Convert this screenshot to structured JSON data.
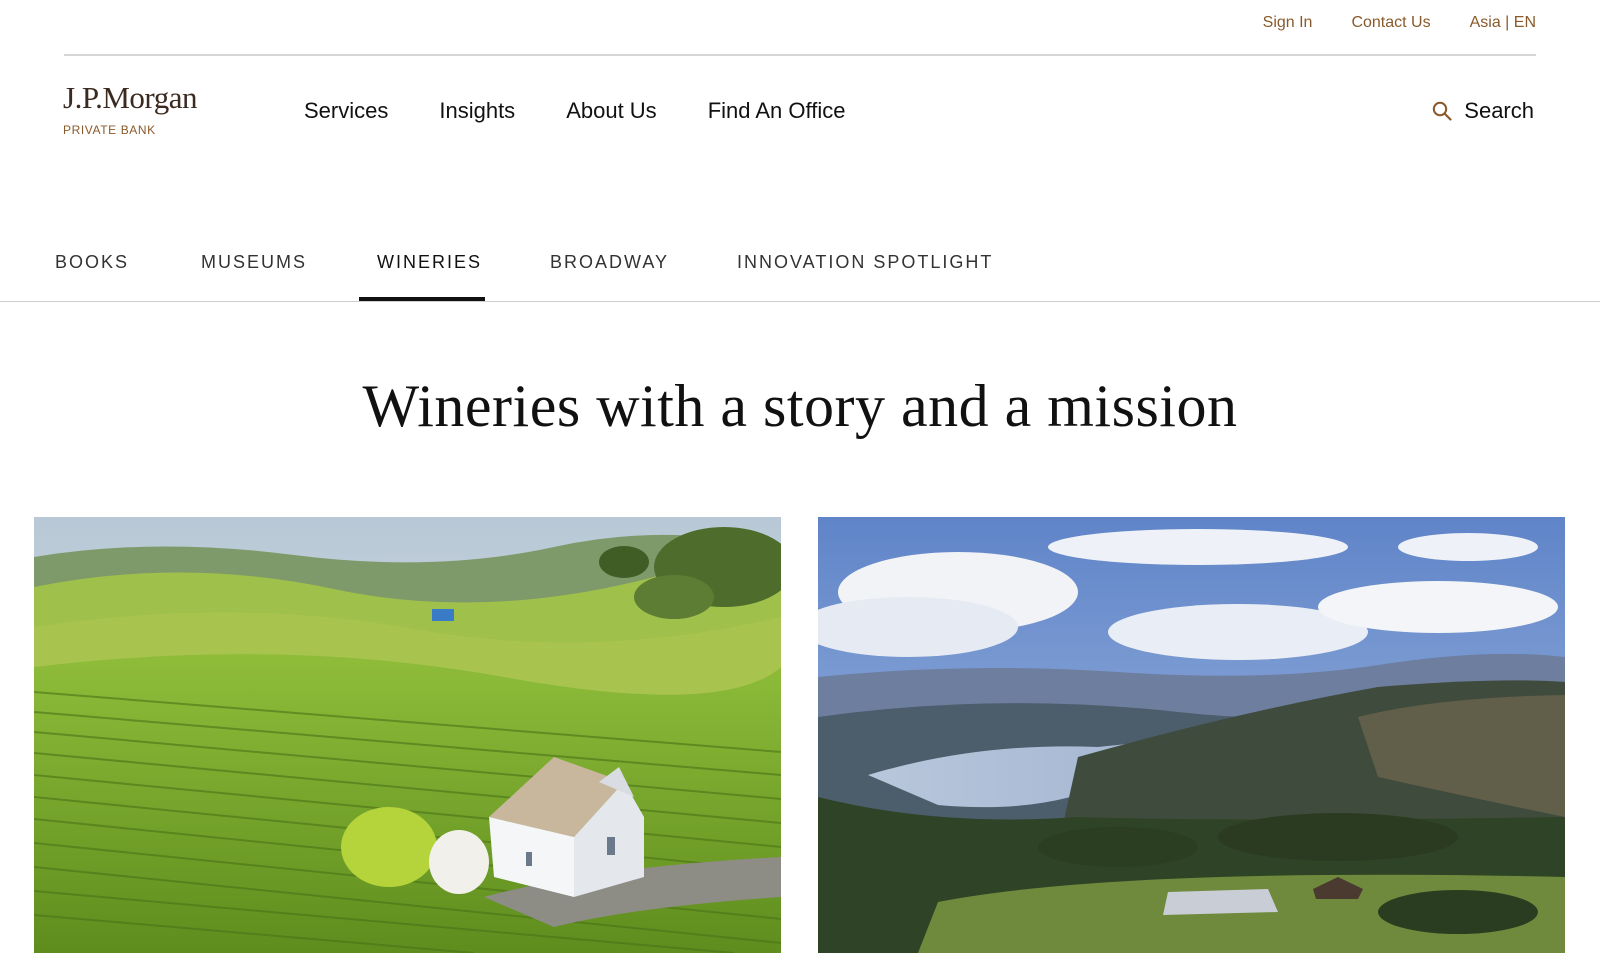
{
  "utility_nav": {
    "sign_in": "Sign In",
    "contact_us": "Contact Us",
    "region": "Asia | EN"
  },
  "brand": {
    "name": "J.P.Morgan",
    "sub": "PRIVATE BANK",
    "accent_color": "#8a5a2b"
  },
  "main_nav": {
    "items": [
      {
        "label": "Services"
      },
      {
        "label": "Insights"
      },
      {
        "label": "About Us"
      },
      {
        "label": "Find An Office"
      }
    ],
    "search_label": "Search",
    "search_icon": "search-icon"
  },
  "tabs": {
    "items": [
      {
        "label": "BOOKS"
      },
      {
        "label": "MUSEUMS"
      },
      {
        "label": "WINERIES"
      },
      {
        "label": "BROADWAY"
      },
      {
        "label": "INNOVATION SPOTLIGHT"
      }
    ],
    "active": "WINERIES"
  },
  "page": {
    "title": "Wineries with a story and a mission"
  },
  "cards": [
    {
      "image": "vineyard-chapel-photo"
    },
    {
      "image": "lake-valley-aerial-photo"
    }
  ]
}
